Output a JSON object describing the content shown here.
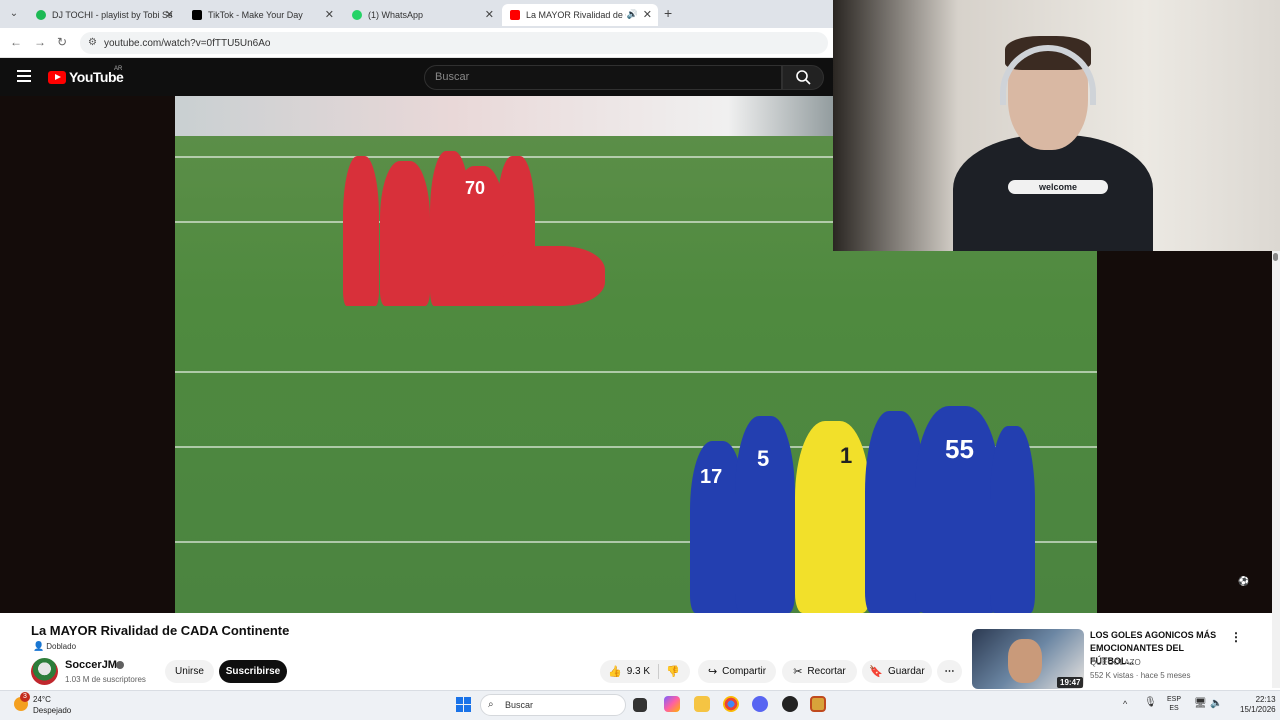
{
  "browser": {
    "tabs": [
      {
        "title": "DJ TOCHI - playlist by Tobi Sanc",
        "favicon_color": "#1db954",
        "active": false
      },
      {
        "title": "TikTok - Make Your Day",
        "favicon_color": "#000000",
        "active": false
      },
      {
        "title": "(1) WhatsApp",
        "favicon_color": "#25d366",
        "active": false
      },
      {
        "title": "La MAYOR Rivalidad de CADA",
        "favicon_color": "#ff0000",
        "active": true
      }
    ],
    "url": "youtube.com/watch?v=0fTTU5Un6Ao"
  },
  "youtube": {
    "wordmark": "YouTube",
    "country": "AR",
    "search_placeholder": "Buscar"
  },
  "webcam": {
    "shirt_text": "welcome"
  },
  "video": {
    "title": "La MAYOR Rivalidad de CADA Continente",
    "badge": "Doblado",
    "channel": "SoccerJM",
    "subscribers": "1.03 M de suscriptores",
    "join_label": "Unirse",
    "subscribe_label": "Suscribirse",
    "likes": "9.3 K",
    "share_label": "Compartir",
    "clip_label": "Recortar",
    "save_label": "Guardar",
    "jersey_numbers": [
      "70",
      "17",
      "5",
      "1",
      "55"
    ]
  },
  "suggested": {
    "title": "LOS GOLES AGONICOS MÁS EMOCIONANTES DEL FÚTBOL...",
    "channel": "QUEGOLAZO",
    "meta": "552 K vistas · hace 5 meses",
    "duration": "19:47"
  },
  "taskbar": {
    "weather_temp": "24°C",
    "weather_desc": "Despejado",
    "weather_badge": "3",
    "search_placeholder": "Buscar",
    "lang_line1": "ESP",
    "lang_line2": "ES",
    "time": "22:13",
    "date": "15/1/2026"
  }
}
